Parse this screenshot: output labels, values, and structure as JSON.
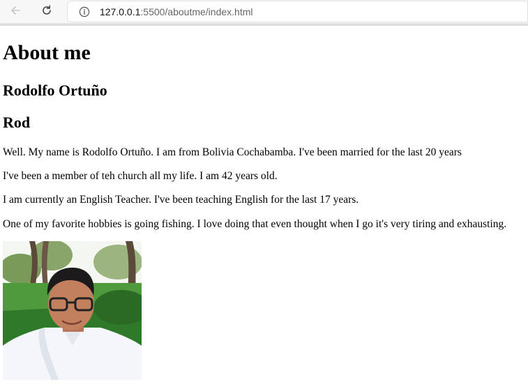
{
  "browser": {
    "url_host": "127.0.0.1",
    "url_path": ":5500/aboutme/index.html",
    "icons": {
      "back": "arrow-left-icon",
      "reload": "reload-icon",
      "site_info": "info-icon"
    }
  },
  "page": {
    "title": "About me",
    "name": "Rodolfo Ortuño",
    "nickname": "Rod",
    "paragraphs": [
      "Well. My name is Rodolfo Ortuño. I am from Bolivia Cochabamba. I've been married for the last 20 years",
      "I've been a member of teh church all my life. I am 42 years old.",
      "I am currently an English Teacher. I've been teaching English for the last 17 years.",
      "One of my favorite hobbies is going fishing. I love doing that even thought when I go it's very tiring and exhausting."
    ]
  }
}
